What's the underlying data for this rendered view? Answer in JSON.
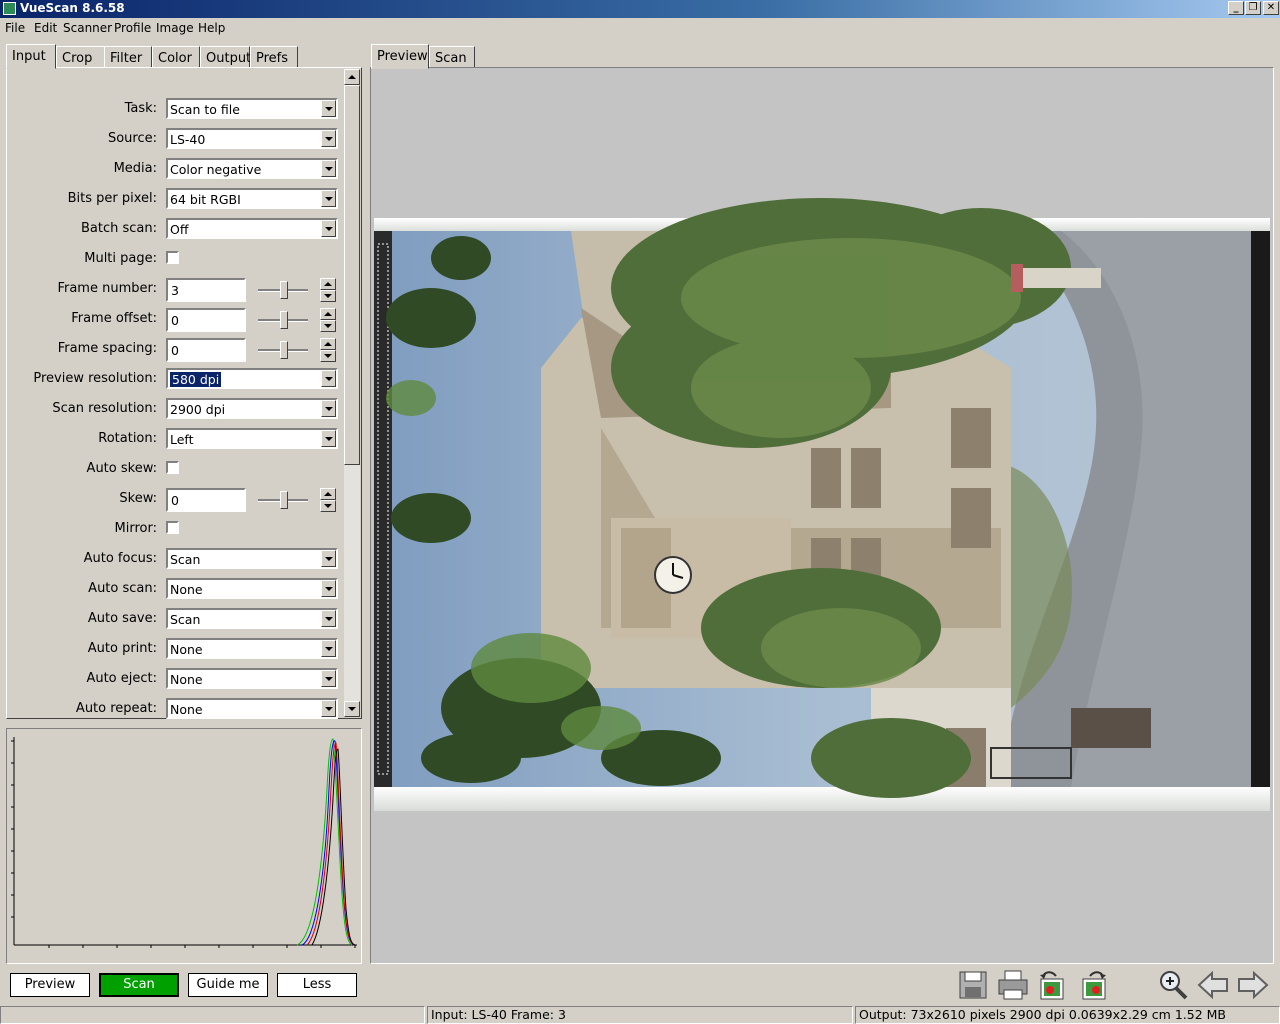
{
  "window": {
    "title": "VueScan 8.6.58"
  },
  "menu": [
    "File",
    "Edit",
    "Scanner",
    "Profile",
    "Image",
    "Help"
  ],
  "left_tabs": [
    "Input",
    "Crop",
    "Filter",
    "Color",
    "Output",
    "Prefs"
  ],
  "right_tabs": [
    "Preview",
    "Scan"
  ],
  "input": {
    "task": {
      "label": "Task:",
      "value": "Scan to file"
    },
    "source": {
      "label": "Source:",
      "value": "LS-40"
    },
    "media": {
      "label": "Media:",
      "value": "Color negative"
    },
    "bits": {
      "label": "Bits per pixel:",
      "value": "64 bit RGBI"
    },
    "batch": {
      "label": "Batch scan:",
      "value": "Off"
    },
    "multi": {
      "label": "Multi page:",
      "checked": false
    },
    "frame_number": {
      "label": "Frame number:",
      "value": "3"
    },
    "frame_offset": {
      "label": "Frame offset:",
      "value": "0"
    },
    "frame_spacing": {
      "label": "Frame spacing:",
      "value": "0"
    },
    "preview_res": {
      "label": "Preview resolution:",
      "value": "580 dpi"
    },
    "scan_res": {
      "label": "Scan resolution:",
      "value": "2900 dpi"
    },
    "rotation": {
      "label": "Rotation:",
      "value": "Left"
    },
    "auto_skew": {
      "label": "Auto skew:",
      "checked": false
    },
    "skew": {
      "label": "Skew:",
      "value": "0"
    },
    "mirror": {
      "label": "Mirror:",
      "checked": false
    },
    "auto_focus": {
      "label": "Auto focus:",
      "value": "Scan"
    },
    "auto_scan": {
      "label": "Auto scan:",
      "value": "None"
    },
    "auto_save": {
      "label": "Auto save:",
      "value": "Scan"
    },
    "auto_print": {
      "label": "Auto print:",
      "value": "None"
    },
    "auto_eject": {
      "label": "Auto eject:",
      "value": "None"
    },
    "auto_repeat": {
      "label": "Auto repeat:",
      "value": "None"
    }
  },
  "buttons": {
    "preview": "Preview",
    "scan": "Scan",
    "guide": "Guide me",
    "less": "Less"
  },
  "status": {
    "input": "Input: LS-40 Frame: 3",
    "output": "Output: 73x2610 pixels 2900 dpi 0.0639x2.29 cm 1.52 MB"
  },
  "toolbar_icons": [
    "save-icon",
    "print-icon",
    "rotate-left-icon",
    "rotate-right-icon",
    "zoom-in-icon",
    "previous-icon",
    "next-icon"
  ],
  "colors": {
    "scan_button": "#00a000",
    "title_bar": "#0a246a",
    "selection": "#0a246a"
  }
}
